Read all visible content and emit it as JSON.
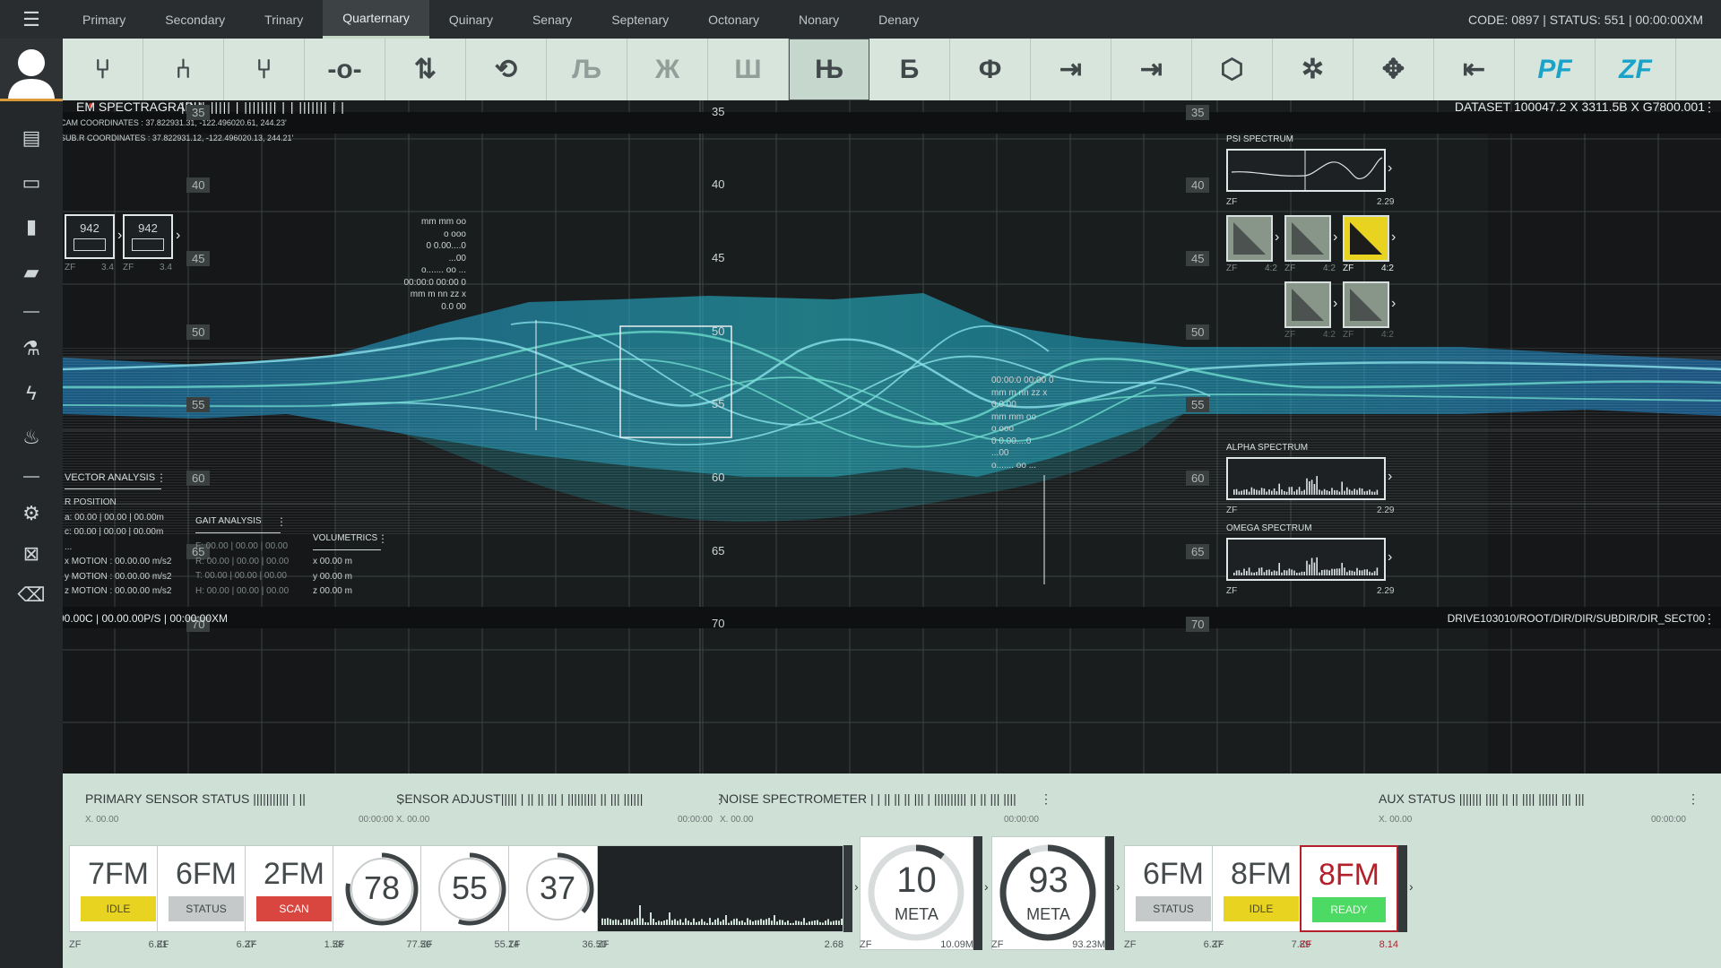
{
  "topbar": {
    "tabs": [
      "Primary",
      "Secondary",
      "Trinary",
      "Quarternary",
      "Quinary",
      "Senary",
      "Septenary",
      "Octonary",
      "Nonary",
      "Denary"
    ],
    "active_tab": "Quarternary",
    "status": "CODE: 0897 | STATUS: 551 | 00:00:00XM"
  },
  "toolbar": {
    "tools": [
      "⑂",
      "⑃",
      "⑂",
      "-o-",
      "⇅",
      "⟲",
      "Љ",
      "Ж",
      "Ш",
      "Њ",
      "Б",
      "Ф",
      "⇥",
      "⇥",
      "⬡",
      "✲",
      "✥",
      "⇤",
      "PF",
      "ZF"
    ]
  },
  "viz": {
    "title": "EM SPECTRAGRAPH",
    "dataset": "DATASET 100047.2 X 3311.5B X G7800.001",
    "cam_coords": "CAM COORDINATES : 37.822931.31, -122.496020.61, 244.23'",
    "sub_coords": "SUB.R COORDINATES : 37.822931.12, -122.496020.13, 244.21'",
    "ticks": [
      "35",
      "40",
      "45",
      "50",
      "55",
      "60",
      "65",
      "70"
    ],
    "footer_left": "00.00C | 00.00.00P/S | 00:00:00XM",
    "footer_right": "DRIVE103010/ROOT/DIR/DIR/SUBDIR/DIR_SECT00",
    "thumbs": [
      {
        "value": "942",
        "zf": "ZF",
        "num": "3.4"
      },
      {
        "value": "942",
        "zf": "ZF",
        "num": "3.4"
      }
    ],
    "readout_a": [
      "mm mm oo",
      "o ooo",
      "0 0.00....0",
      "...00",
      "o....... oo ...",
      "00:00:0  00:00  0",
      "mm m nn zz x",
      "0.0  00"
    ],
    "readout_b": [
      "00:00:0  00:00  0",
      "mm m nn zz x",
      "0.0  00",
      "mm mm oo",
      "o ooo",
      "0 0.00....0",
      "...00",
      "o....... oo ..."
    ],
    "vector": {
      "title": "VECTOR ANALYSIS",
      "lines": [
        "R POSITION",
        "a: 00.00 | 00.00 | 00.00m",
        "c: 00.00 | 00.00 | 00.00m",
        "...",
        "x MOTION : 00.00.00 m/s2",
        "y MOTION : 00.00.00 m/s2",
        "z MOTION : 00.00.00 m/s2"
      ]
    },
    "gait": {
      "title": "GAIT ANALYSIS",
      "lines": [
        "F: 00.00 | 00.00 | 00.00",
        "R: 00.00 | 00.00 | 00.00",
        "T: 00.00 | 00.00 | 00.00",
        "H: 00.00 | 00.00 | 00.00"
      ]
    },
    "volumetrics": {
      "title": "VOLUMETRICS",
      "lines": [
        "x 00.00 m",
        "y 00.00 m",
        "z 00.00 m"
      ]
    },
    "psi": {
      "title": "PSI SPECTRUM",
      "zf": "ZF",
      "value": "2.29"
    },
    "alpha": {
      "title": "ALPHA SPECTRUM",
      "zf": "ZF",
      "value": "2.29"
    },
    "omega": {
      "title": "OMEGA SPECTRUM",
      "zf": "ZF",
      "value": "2.29"
    },
    "cells": [
      {
        "zf": "ZF",
        "num": "4:2"
      },
      {
        "zf": "ZF",
        "num": "4:2"
      },
      {
        "zf": "ZF",
        "num": "4:2"
      },
      {
        "zf": "ZF",
        "num": "4:2"
      },
      {
        "zf": "ZF",
        "num": "4:2"
      }
    ]
  },
  "bottom": {
    "sections": [
      {
        "title": "PRIMARY SENSOR STATUS ||||||||||| | ||",
        "sub_l": "X. 00.00",
        "sub_r": "00:00:00"
      },
      {
        "title": "SENSOR ADJUST||||| | || ||  ||| | ||||||||| || ||| ||||||",
        "sub_l": "X. 00.00",
        "sub_r": "00:00:00"
      },
      {
        "title": "NOISE SPECTROMETER | | || ||  || ||| | |||||||||| || || ||| ||||",
        "sub_l": "X. 00.00",
        "sub_r": "00:00:00"
      },
      {
        "title": "AUX STATUS ||||||| |||| || ||  |||| ||||||   |||   |||",
        "sub_l": "X. 00.00",
        "sub_r": "00:00:00"
      }
    ],
    "cards": [
      {
        "big": "7FM",
        "badge": "IDLE",
        "zf": "ZF",
        "val": "6.81"
      },
      {
        "big": "6FM",
        "badge": "STATUS",
        "zf": "ZF",
        "val": "6.37"
      },
      {
        "big": "2FM",
        "badge": "SCAN",
        "zf": "ZF",
        "val": "1.58"
      },
      {
        "big": "78",
        "zf": "ZF",
        "val": "77.50"
      },
      {
        "big": "55",
        "zf": "ZF",
        "val": "55.14"
      },
      {
        "big": "37",
        "zf": "ZF",
        "val": "36.50"
      },
      {
        "zf": "ZF",
        "val": "2.68"
      },
      {
        "big": "10",
        "label": "META",
        "zf": "ZF",
        "val": "10.09M"
      },
      {
        "big": "93",
        "label": "META",
        "zf": "ZF",
        "val": "93.23M"
      },
      {
        "big": "6FM",
        "badge": "STATUS",
        "zf": "ZF",
        "val": "6.37"
      },
      {
        "big": "8FM",
        "badge": "IDLE",
        "zf": "ZF",
        "val": "7.89"
      },
      {
        "big": "8FM",
        "badge": "READY",
        "zf": "ZF",
        "val": "8.14"
      }
    ]
  },
  "colors": {
    "accent": "#1aa3c8",
    "idle": "#e8d321",
    "scan": "#d9463f",
    "ready": "#4cd964",
    "alert": "#b51f2a",
    "status": "#c5c9c9"
  }
}
